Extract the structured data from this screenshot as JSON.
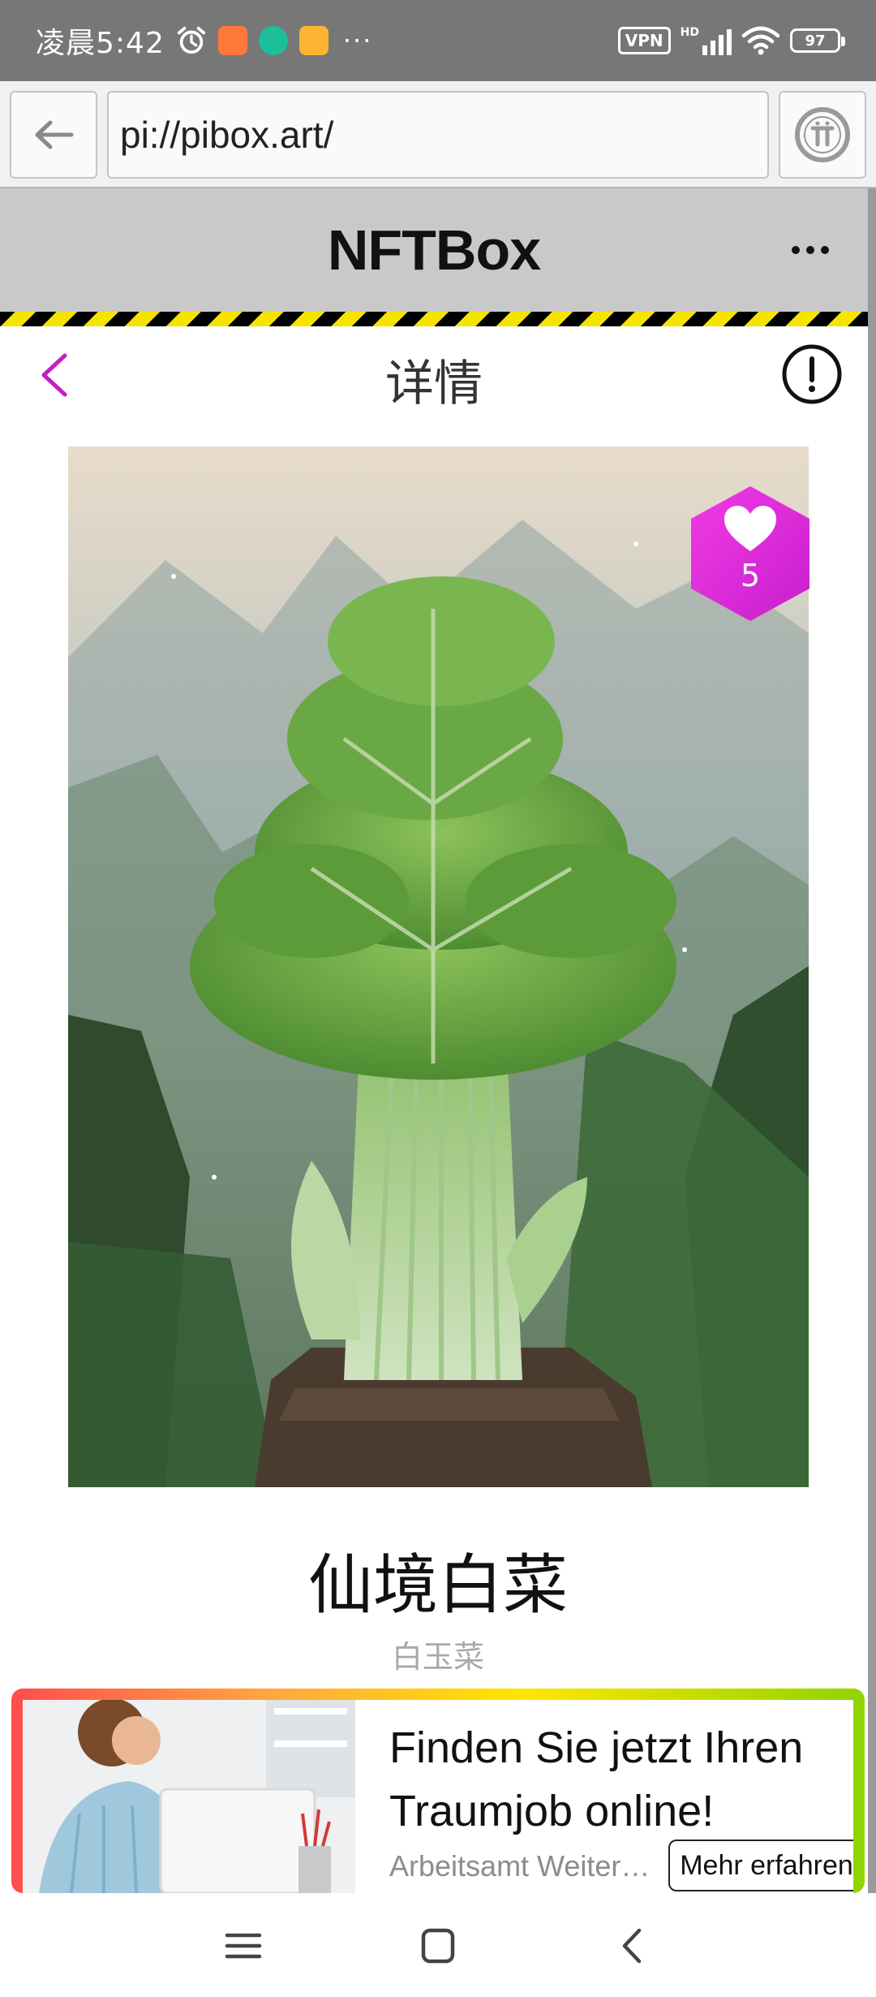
{
  "status_bar": {
    "time": "凌晨5:42",
    "vpn": "VPN",
    "network": "HD",
    "battery": "97",
    "more": "···",
    "app_colors": [
      "#ff7a3a",
      "#1bbf9a",
      "#ffb433"
    ]
  },
  "browser": {
    "url": "pi://pibox.art/"
  },
  "app": {
    "title": "NFTBox"
  },
  "detail": {
    "title": "详情"
  },
  "nft": {
    "name": "仙境白菜",
    "subtitle": "白玉菜",
    "likes": "5",
    "image_subject": "giant bok choy in misty mountains"
  },
  "ad": {
    "headline": "Finden Sie jetzt Ihren Traumjob online!",
    "sponsor": "Arbeitsamt Weiterbildung",
    "cta": "Mehr erfahren"
  },
  "colors": {
    "accent": "#d21fd8",
    "like_badge": "#e01dd5",
    "hazard_yellow": "#f5e400",
    "header_bg": "#c9c9c9",
    "status_bar_bg": "#777777"
  }
}
